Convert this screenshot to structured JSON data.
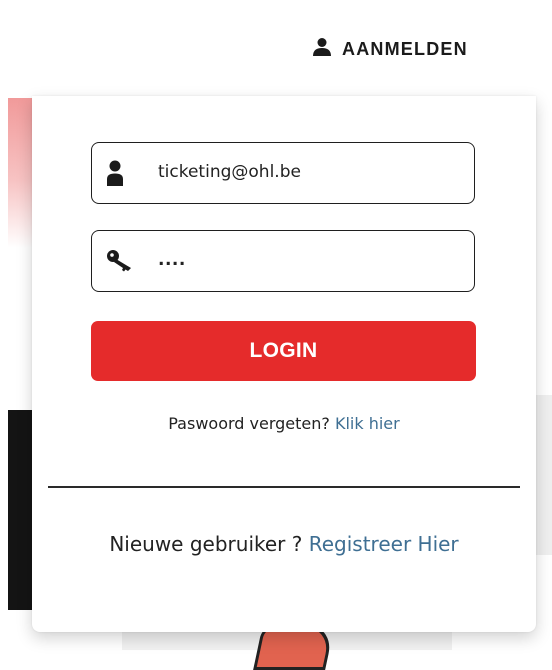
{
  "header": {
    "signin_label": "AANMELDEN",
    "signin_icon": "user-icon"
  },
  "login_form": {
    "email_value": "ticketing@ohl.be",
    "email_icon": "user-icon",
    "password_value": "....",
    "password_icon": "key-icon",
    "login_button": "LOGIN",
    "forgot_text": "Paswoord vergeten?",
    "forgot_link": "Klik hier",
    "new_user_text": "Nieuwe gebruiker ?",
    "register_link": "Registreer Hier"
  },
  "colors": {
    "accent": "#e52b2b",
    "link": "#3f6f93",
    "text": "#222222"
  }
}
